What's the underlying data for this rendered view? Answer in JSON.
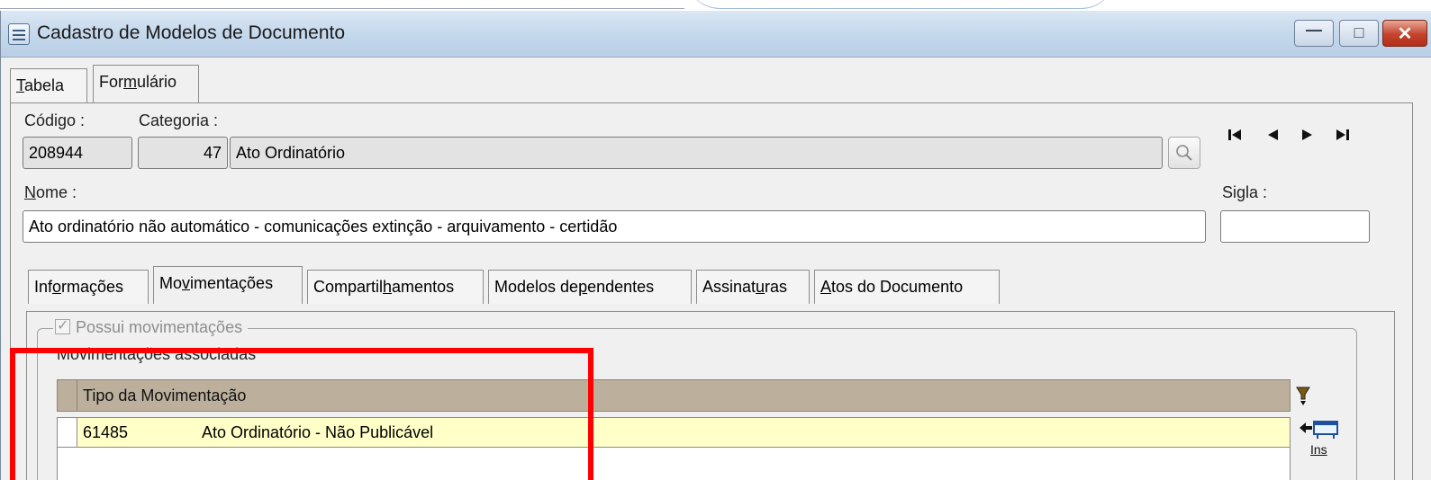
{
  "window": {
    "title": "Cadastro de Modelos de Documento",
    "controls": {
      "minimize": "—",
      "maximize": "□",
      "close": "✕"
    }
  },
  "tabs": [
    {
      "label": "Tabela",
      "mnemonic": "T",
      "rest": "abela",
      "active": false
    },
    {
      "label": "Formulário",
      "pre": "For",
      "mnemonic": "m",
      "rest": "ulário",
      "active": true
    }
  ],
  "form": {
    "codigo": {
      "label": "Código :",
      "value": "208944"
    },
    "categoria": {
      "label": "Categoria :",
      "code": "47",
      "name": "Ato Ordinatório"
    },
    "nome": {
      "label_mnemonic": "N",
      "label_rest": "ome :",
      "label": "Nome :",
      "value": "Ato ordinatório não automático - comunicações extinção - arquivamento - certidão"
    },
    "sigla": {
      "label_pre": "Si",
      "label_mnemonic": "g",
      "label_rest": "la :",
      "label": "Sigla :",
      "value": ""
    }
  },
  "navigation": {
    "first": "⏮",
    "prev": "◄",
    "next": "►",
    "last": "⏭"
  },
  "inner_tabs": [
    {
      "label": "Informações",
      "pre": "Inf",
      "mnemonic": "o",
      "rest": "rmações",
      "active": false
    },
    {
      "label": "Movimentações",
      "pre": "Mo",
      "mnemonic": "v",
      "rest": "imentações",
      "active": true
    },
    {
      "label": "Compartilhamentos",
      "pre": "Compartil",
      "mnemonic": "h",
      "rest": "amentos",
      "active": false
    },
    {
      "label": "Modelos dependentes",
      "pre": "Modelos de",
      "mnemonic": "p",
      "rest": "endentes",
      "active": false
    },
    {
      "label": "Assinaturas",
      "pre": "Assinat",
      "mnemonic": "u",
      "rest": "ras",
      "active": false
    },
    {
      "label": "Atos do Documento",
      "pre": "",
      "mnemonic": "A",
      "rest": "tos do Documento",
      "active": false
    }
  ],
  "movimentacoes": {
    "possui_label": "Possui movimentações",
    "possui_checked": true,
    "associadas_label": "Movimentações associadas",
    "grid": {
      "columns": [
        "Tipo da Movimentação"
      ],
      "rows": [
        {
          "code": "61485",
          "name": "Ato Ordinatório - Não Publicável"
        }
      ]
    },
    "ins_label": "Ins"
  },
  "colors": {
    "highlight": "#ff0000",
    "grid_header": "#bcb09c",
    "selected_row": "#ffffc8"
  }
}
